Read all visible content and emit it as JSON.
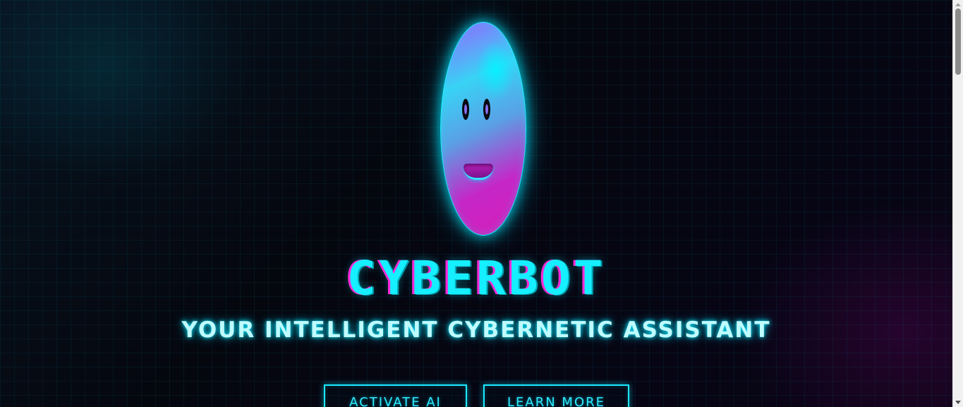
{
  "hero": {
    "title": "CYBERBOT",
    "subtitle": "YOUR INTELLIGENT CYBERNETIC ASSISTANT"
  },
  "actions": {
    "activate_label": "ACTIVATE AI",
    "learn_more_label": "LEARN MORE"
  },
  "theme": {
    "accent_cyan": "#15efff",
    "accent_magenta": "#ff27d8",
    "background": "#05060f"
  },
  "icons": {
    "robot": "robot-face-icon",
    "scroll_up": "chevron-up-icon",
    "scroll_down": "chevron-down-icon"
  }
}
